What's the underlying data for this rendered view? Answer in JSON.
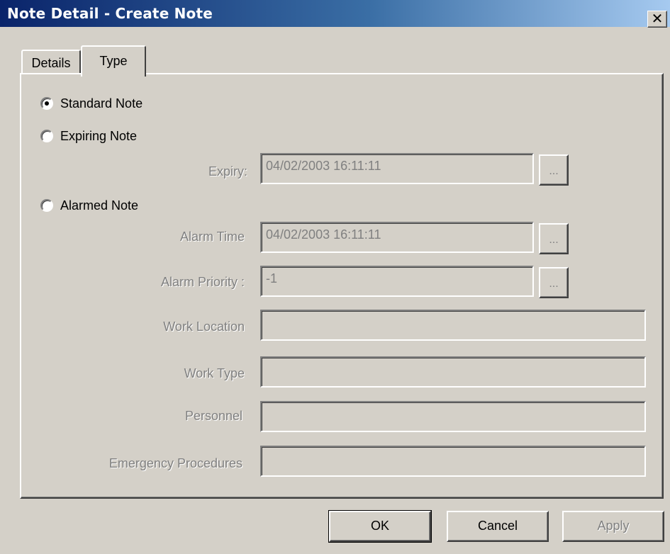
{
  "window": {
    "title": "Note Detail - Create Note",
    "close_glyph": "✕"
  },
  "tabs": [
    {
      "label": "Details",
      "active": false
    },
    {
      "label": "Type",
      "active": true
    }
  ],
  "note_type": {
    "selected": "Standard Note",
    "options": [
      {
        "label": "Standard Note",
        "checked": true
      },
      {
        "label": "Expiring Note",
        "checked": false
      },
      {
        "label": "Alarmed Note",
        "checked": false
      }
    ]
  },
  "expiry": {
    "label": "Expiry:",
    "value": "04/02/2003 16:11:11",
    "button": "..."
  },
  "alarm_time": {
    "label": "Alarm Time",
    "value": "04/02/2003 16:11:11",
    "button": "..."
  },
  "alarm_priority": {
    "label": "Alarm Priority :",
    "value": "-1",
    "button": "..."
  },
  "work_location": {
    "label": "Work Location",
    "value": ""
  },
  "work_type": {
    "label": "Work Type",
    "value": ""
  },
  "personnel": {
    "label": "Personnel",
    "value": ""
  },
  "emergency_procedures": {
    "label": "Emergency Procedures",
    "value": ""
  },
  "buttons": {
    "ok": "OK",
    "cancel": "Cancel",
    "apply": "Apply"
  },
  "colors": {
    "titlebar_start": "#0a246a",
    "titlebar_end": "#a6caf0",
    "face": "#d4d0c8",
    "disabled_text": "#808080"
  }
}
